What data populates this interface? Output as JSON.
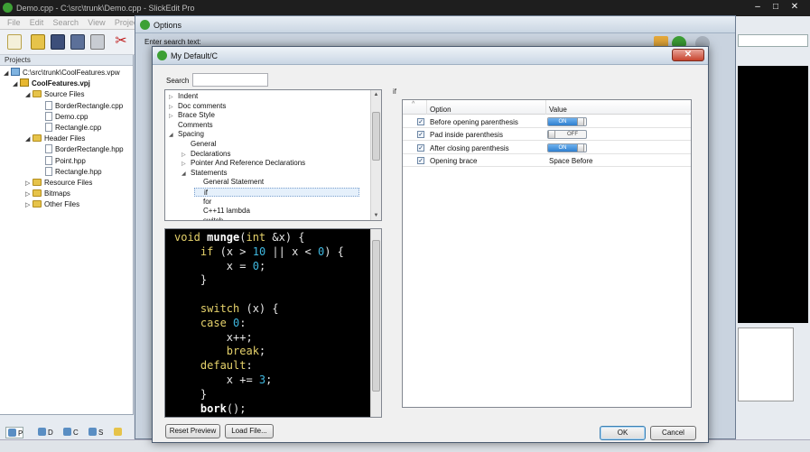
{
  "ide": {
    "title": "Demo.cpp - C:\\src\\trunk\\Demo.cpp - SlickEdit Pro",
    "menu": [
      "File",
      "Edit",
      "Search",
      "View",
      "Projec"
    ],
    "projects_header": "Projects",
    "tree": [
      {
        "label": "C:\\src\\trunk\\CoolFeatures.vpw",
        "kind": "ws",
        "bold": false
      },
      {
        "label": "CoolFeatures.vpj",
        "kind": "proj",
        "bold": true
      },
      {
        "label": "Source Files",
        "kind": "folder",
        "bold": false
      },
      {
        "label": "BorderRectangle.cpp",
        "kind": "file",
        "bold": false
      },
      {
        "label": "Demo.cpp",
        "kind": "file",
        "bold": false
      },
      {
        "label": "Rectangle.cpp",
        "kind": "file",
        "bold": false
      },
      {
        "label": "Header Files",
        "kind": "folder",
        "bold": false
      },
      {
        "label": "BorderRectangle.hpp",
        "kind": "file",
        "bold": false
      },
      {
        "label": "Point.hpp",
        "kind": "file",
        "bold": false
      },
      {
        "label": "Rectangle.hpp",
        "kind": "file",
        "bold": false
      },
      {
        "label": "Resource Files",
        "kind": "folder",
        "bold": false
      },
      {
        "label": "Bitmaps",
        "kind": "folder",
        "bold": false
      },
      {
        "label": "Other Files",
        "kind": "folder",
        "bold": false
      }
    ],
    "panel_tabs": [
      "P",
      "D",
      "C",
      "S"
    ]
  },
  "options_window": {
    "title": "Options",
    "search_label": "Enter search text:"
  },
  "dialog": {
    "title": "My Default/C",
    "close_label": "✕",
    "search_label": "Search",
    "search_value": "",
    "tree": [
      {
        "label": "Indent",
        "expander": "▷",
        "depth": 0
      },
      {
        "label": "Doc comments",
        "expander": "▷",
        "depth": 0
      },
      {
        "label": "Brace Style",
        "expander": "▷",
        "depth": 0
      },
      {
        "label": "Comments",
        "expander": "",
        "depth": 0
      },
      {
        "label": "Spacing",
        "expander": "◢",
        "depth": 0
      },
      {
        "label": "General",
        "expander": "",
        "depth": 1
      },
      {
        "label": "Declarations",
        "expander": "▷",
        "depth": 1
      },
      {
        "label": "Pointer And Reference Declarations",
        "expander": "▷",
        "depth": 1
      },
      {
        "label": "Statements",
        "expander": "◢",
        "depth": 1
      },
      {
        "label": "General Statement",
        "expander": "",
        "depth": 2
      },
      {
        "label": "if",
        "expander": "",
        "depth": 2,
        "selected": true
      },
      {
        "label": "for",
        "expander": "",
        "depth": 2
      },
      {
        "label": "C++11 lambda",
        "expander": "",
        "depth": 2
      },
      {
        "label": "switch",
        "expander": "",
        "depth": 2
      }
    ],
    "section_title": "if",
    "grid": {
      "sort_indicator": "^",
      "col_option": "Option",
      "col_value": "Value",
      "rows": [
        {
          "checked": true,
          "label": "Before opening parenthesis",
          "type": "toggle",
          "value": "ON"
        },
        {
          "checked": true,
          "label": "Pad inside parenthesis",
          "type": "toggle",
          "value": "OFF"
        },
        {
          "checked": true,
          "label": "After closing parenthesis",
          "type": "toggle",
          "value": "ON"
        },
        {
          "checked": true,
          "label": "Opening brace",
          "type": "text",
          "value": "Space Before"
        }
      ]
    },
    "preview_code": [
      [
        [
          "kw",
          "void "
        ],
        [
          "fn",
          "munge"
        ],
        [
          "",
          "("
        ],
        [
          "kw",
          "int "
        ],
        [
          "",
          "&x) {"
        ]
      ],
      [
        [
          "",
          "    "
        ],
        [
          "kw",
          "if "
        ],
        [
          "",
          "(x > "
        ],
        [
          "num",
          "10"
        ],
        [
          "",
          " || x < "
        ],
        [
          "num",
          "0"
        ],
        [
          "",
          ") {"
        ]
      ],
      [
        [
          "",
          "        x = "
        ],
        [
          "num",
          "0"
        ],
        [
          "",
          ";"
        ]
      ],
      [
        [
          "",
          "    }"
        ]
      ],
      [
        [
          "",
          ""
        ]
      ],
      [
        [
          "",
          "    "
        ],
        [
          "kw",
          "switch "
        ],
        [
          "",
          "(x) {"
        ]
      ],
      [
        [
          "",
          "    "
        ],
        [
          "kw",
          "case "
        ],
        [
          "num",
          "0"
        ],
        [
          "",
          ":"
        ]
      ],
      [
        [
          "",
          "        x++;"
        ]
      ],
      [
        [
          "",
          "        "
        ],
        [
          "kw",
          "break"
        ],
        [
          "",
          ";"
        ]
      ],
      [
        [
          "",
          "    "
        ],
        [
          "kw",
          "default"
        ],
        [
          "",
          ":"
        ]
      ],
      [
        [
          "",
          "        x += "
        ],
        [
          "num",
          "3"
        ],
        [
          "",
          ";"
        ]
      ],
      [
        [
          "",
          "    }"
        ]
      ],
      [
        [
          "",
          "    "
        ],
        [
          "fn",
          "bork"
        ],
        [
          "",
          "();"
        ]
      ]
    ],
    "buttons": {
      "reset_preview": "Reset Preview",
      "load_file": "Load File...",
      "ok": "OK",
      "cancel": "Cancel"
    }
  },
  "colors": {
    "accent": "#2f7fcf",
    "keyword": "#e6d26b",
    "number": "#3fb8e0"
  }
}
